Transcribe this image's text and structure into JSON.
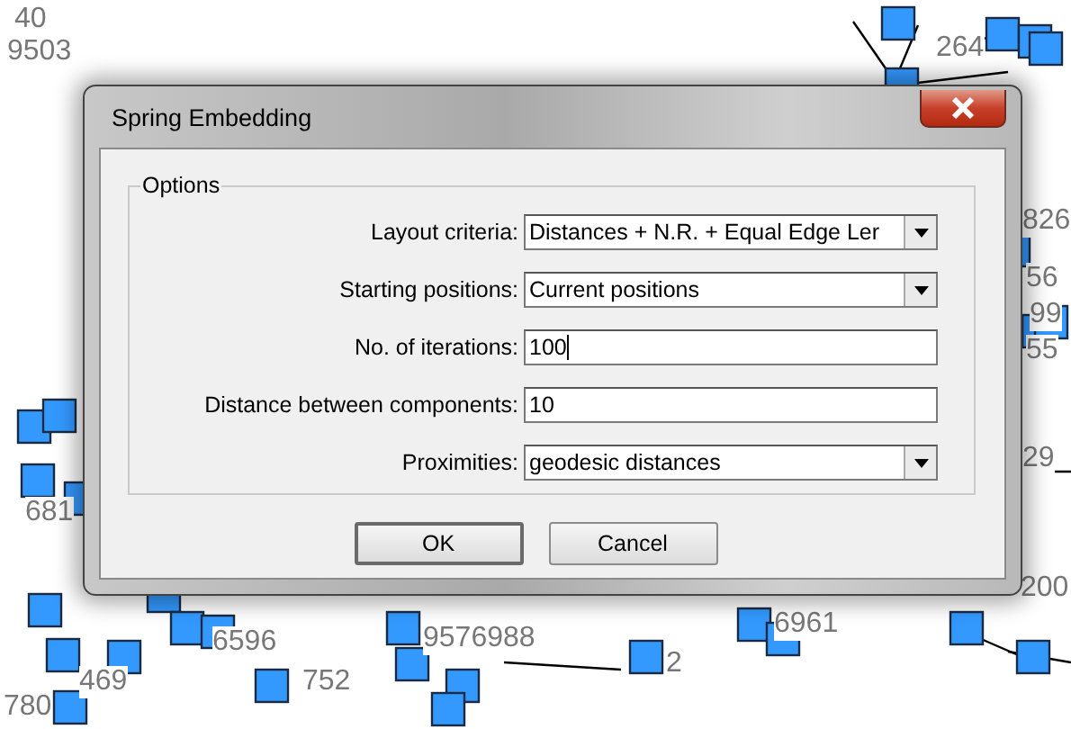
{
  "graph_labels": [
    "40",
    "9503",
    "264",
    "826",
    "56",
    "99",
    "55",
    "29",
    "200",
    "681",
    "6596",
    "469",
    "780",
    "9576988",
    "2",
    "6961",
    "752"
  ],
  "window": {
    "title": "Spring Embedding"
  },
  "group": {
    "title": "Options"
  },
  "fields": [
    {
      "kind": "dropdown",
      "label": "Layout criteria:",
      "value": "Distances + N.R. + Equal Edge Ler",
      "focused": false
    },
    {
      "kind": "dropdown",
      "label": "Starting positions:",
      "value": "Current positions",
      "focused": false
    },
    {
      "kind": "text",
      "label": "No. of iterations:",
      "value": "100",
      "focused": true
    },
    {
      "kind": "text",
      "label": "Distance between components:",
      "value": "10",
      "focused": false
    },
    {
      "kind": "dropdown",
      "label": "Proximities:",
      "value": "geodesic distances",
      "focused": false
    }
  ],
  "buttons": [
    {
      "label": "OK",
      "default": true
    },
    {
      "label": "Cancel",
      "default": false
    }
  ]
}
